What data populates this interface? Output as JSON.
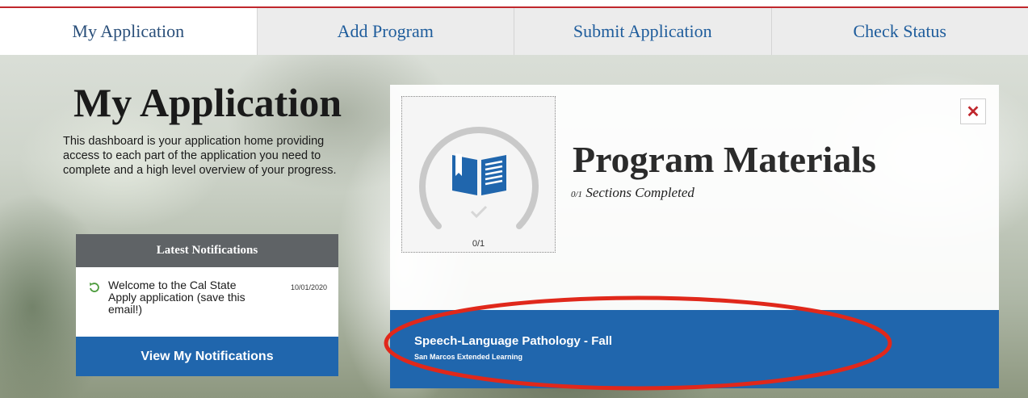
{
  "tabs": [
    {
      "label": "My Application",
      "active": true
    },
    {
      "label": "Add Program",
      "active": false
    },
    {
      "label": "Submit Application",
      "active": false
    },
    {
      "label": "Check Status",
      "active": false
    }
  ],
  "colors": {
    "accent_blue": "#2066ad",
    "tab_text": "#1f5d9c",
    "red_accent": "#c0272d",
    "notif_header_bg": "#5f6366",
    "annotation": "#e0281b"
  },
  "page": {
    "title": "My Application",
    "description": "This dashboard is your application home providing access to each part of the application you need to complete and a high level overview of your progress."
  },
  "notifications": {
    "header": "Latest Notifications",
    "items": [
      {
        "text": "Welcome to the Cal State Apply application (save this email!)",
        "date": "10/01/2020",
        "icon": "refresh-icon"
      }
    ],
    "button_label": "View My Notifications"
  },
  "card": {
    "title": "Program Materials",
    "progress_count": "0/1",
    "progress_fraction": 0,
    "sections_count": "0/1",
    "sections_label": "Sections Completed",
    "icon": "book-icon",
    "close_icon": "close-icon",
    "close_label": "✕",
    "program": {
      "name": "Speech-Language Pathology - Fall",
      "campus": "San Marcos Extended Learning"
    }
  }
}
